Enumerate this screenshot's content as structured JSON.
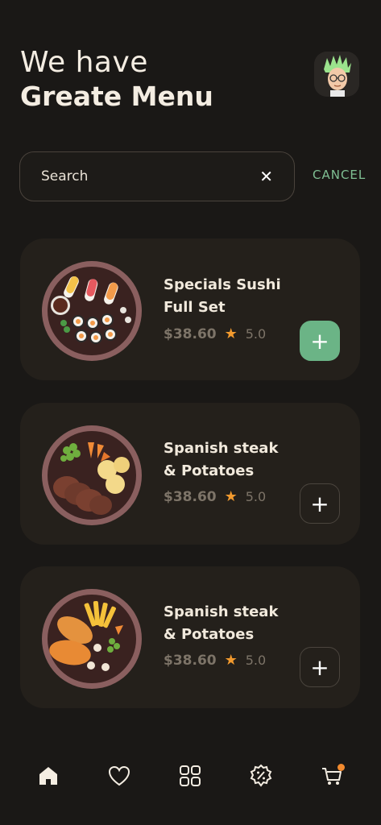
{
  "header": {
    "title_line1": "We have",
    "title_line2": "Greate Menu"
  },
  "search": {
    "value": "Search",
    "clear_icon": "close-icon",
    "cancel_label": "CANCEL"
  },
  "menu_items": [
    {
      "name": "Specials Sushi Full Set",
      "price": "$38.60",
      "rating": "5.0",
      "image": "sushi-plate",
      "added": true
    },
    {
      "name": "Spanish steak & Potatoes",
      "price": "$38.60",
      "rating": "5.0",
      "image": "steak-plate",
      "added": false
    },
    {
      "name": "Spanish steak & Potatoes",
      "price": "$38.60",
      "rating": "5.0",
      "image": "chicken-plate",
      "added": false
    }
  ],
  "bottom_nav": [
    {
      "name": "home-icon",
      "active": true
    },
    {
      "name": "heart-icon",
      "active": false
    },
    {
      "name": "grid-icon",
      "active": false
    },
    {
      "name": "discount-icon",
      "active": false
    },
    {
      "name": "cart-icon",
      "active": false,
      "badge": true
    }
  ],
  "colors": {
    "background": "#1a1816",
    "card": "#24201b",
    "accent_green": "#6bb486",
    "star": "#f29a2e",
    "muted_text": "#7d7468"
  }
}
